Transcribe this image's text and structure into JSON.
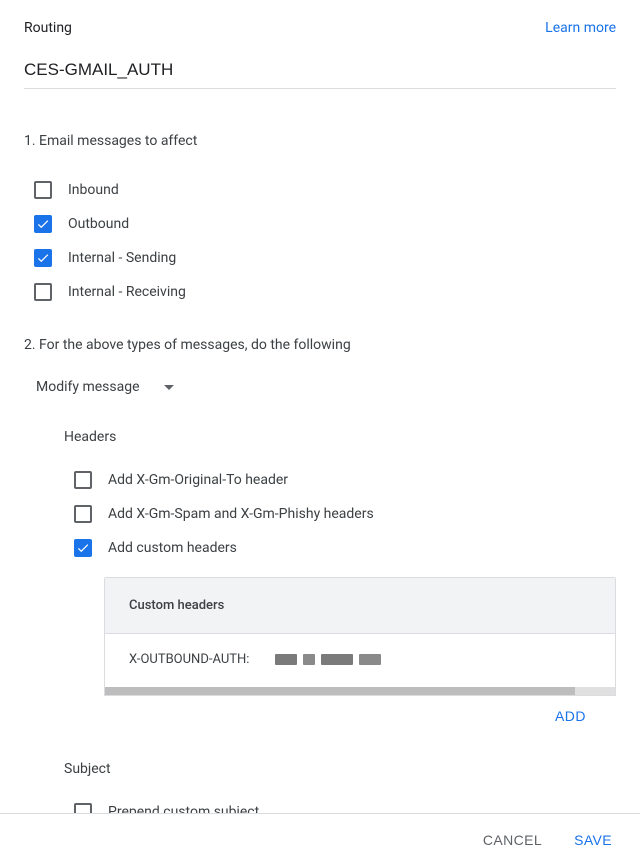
{
  "header": {
    "title": "Routing",
    "learn_more": "Learn more"
  },
  "rule_name": "CES-GMAIL_AUTH",
  "section1": {
    "title": "1. Email messages to affect",
    "options": [
      {
        "label": "Inbound",
        "checked": false
      },
      {
        "label": "Outbound",
        "checked": true
      },
      {
        "label": "Internal - Sending",
        "checked": true
      },
      {
        "label": "Internal - Receiving",
        "checked": false
      }
    ]
  },
  "section2": {
    "title": "2. For the above types of messages, do the following",
    "action": "Modify message",
    "headers": {
      "label": "Headers",
      "options": [
        {
          "label": "Add X-Gm-Original-To header",
          "checked": false
        },
        {
          "label": "Add X-Gm-Spam and X-Gm-Phishy headers",
          "checked": false
        },
        {
          "label": "Add custom headers",
          "checked": true
        }
      ],
      "custom_box_title": "Custom headers",
      "custom_header_key": "X-OUTBOUND-AUTH:",
      "add_button": "ADD"
    },
    "subject": {
      "label": "Subject",
      "prepend_label": "Prepend custom subject"
    }
  },
  "footer": {
    "cancel": "CANCEL",
    "save": "SAVE"
  }
}
